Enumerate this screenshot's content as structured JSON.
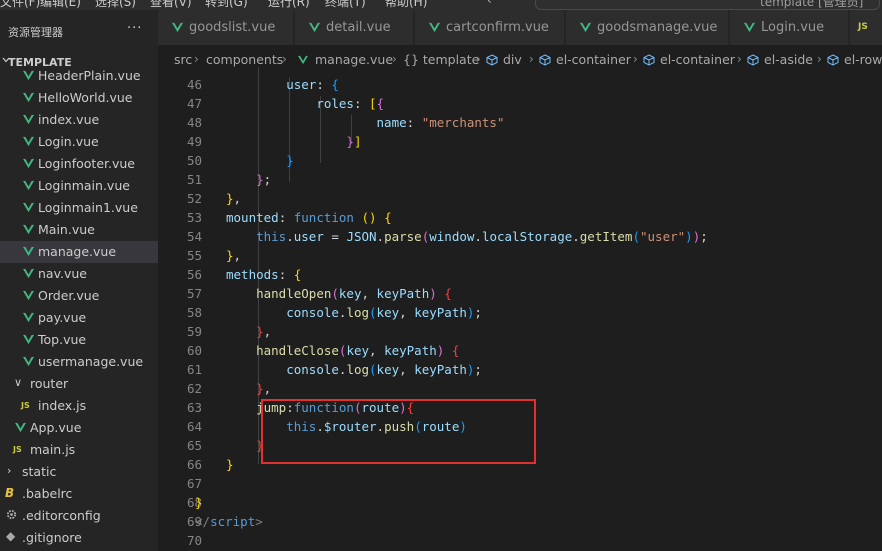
{
  "window": {
    "menu": [
      "文件(F)",
      "编辑(E)",
      "选择(S)",
      "查看(V)",
      "转到(G)",
      "运行(R)",
      "终端(T)",
      "帮助(H)"
    ],
    "title": "template [管理员]"
  },
  "sidebar": {
    "title": "资源管理器",
    "more": "···",
    "section": "TEMPLATE",
    "items": [
      {
        "label": "HeaderPlain.vue",
        "kind": "vue"
      },
      {
        "label": "HelloWorld.vue",
        "kind": "vue"
      },
      {
        "label": "index.vue",
        "kind": "vue"
      },
      {
        "label": "Login.vue",
        "kind": "vue"
      },
      {
        "label": "Loginfooter.vue",
        "kind": "vue"
      },
      {
        "label": "Loginmain.vue",
        "kind": "vue"
      },
      {
        "label": "Loginmain1.vue",
        "kind": "vue"
      },
      {
        "label": "Main.vue",
        "kind": "vue"
      },
      {
        "label": "manage.vue",
        "kind": "vue",
        "active": true
      },
      {
        "label": "nav.vue",
        "kind": "vue"
      },
      {
        "label": "Order.vue",
        "kind": "vue"
      },
      {
        "label": "pay.vue",
        "kind": "vue"
      },
      {
        "label": "Top.vue",
        "kind": "vue"
      },
      {
        "label": "usermanage.vue",
        "kind": "vue"
      },
      {
        "label": "router",
        "kind": "folder-open"
      },
      {
        "label": "index.js",
        "kind": "js"
      },
      {
        "label": "App.vue",
        "kind": "vue"
      },
      {
        "label": "main.js",
        "kind": "js"
      },
      {
        "label": "static",
        "kind": "folder-closed"
      },
      {
        "label": ".babelrc",
        "kind": "babel"
      },
      {
        "label": ".editorconfig",
        "kind": "config"
      },
      {
        "label": ".gitignore",
        "kind": "git"
      }
    ]
  },
  "tabs": [
    {
      "label": "goodslist.vue"
    },
    {
      "label": "detail.vue"
    },
    {
      "label": "cartconfirm.vue"
    },
    {
      "label": "goodsmanage.vue"
    },
    {
      "label": "Login.vue"
    },
    {
      "label": "JS"
    }
  ],
  "breadcrumb": [
    "src",
    "components",
    "manage.vue",
    "{} template",
    "div",
    "el-container",
    "el-container",
    "el-aside",
    "el-row"
  ],
  "editor": {
    "line_numbers": [
      "46",
      "47",
      "48",
      "49",
      "50",
      "51",
      "52",
      "53",
      "54",
      "55",
      "56",
      "57",
      "58",
      "59",
      "60",
      "61",
      "62",
      "63",
      "64",
      "65",
      "66",
      "67",
      "68",
      "69",
      "70"
    ],
    "tokens": {
      "user": "user",
      "roles": "roles",
      "name": "name",
      "merchants": "\"merchants\"",
      "mounted": "mounted",
      "function": "function",
      "this": "this",
      "user_prop": "user",
      "json": "JSON",
      "parse": "parse",
      "window": "window",
      "localStorage": "localStorage",
      "getItem": "getItem",
      "user_str": "\"user\"",
      "methods": "methods",
      "handleOpen": "handleOpen",
      "key": "key",
      "keyPath": "keyPath",
      "console": "console",
      "log": "log",
      "handleClose": "handleClose",
      "jump": "jump",
      "route": "route",
      "router": "$router",
      "push": "push",
      "script": "script"
    }
  },
  "colors": {
    "highlight_box": "#e03030",
    "vue_green": "#41b883",
    "js_yellow": "#cbcb41"
  }
}
